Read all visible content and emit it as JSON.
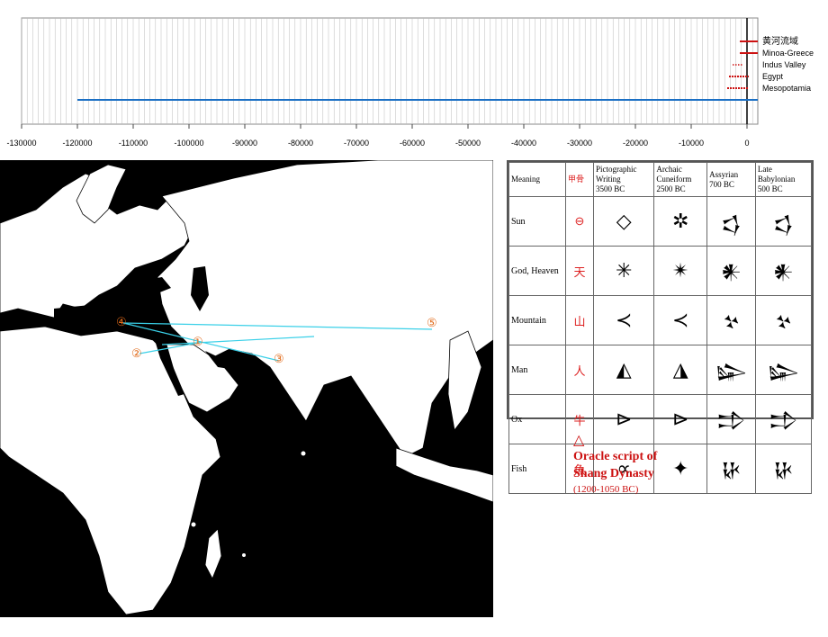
{
  "timeline": {
    "axis_ticks": [
      "-130000",
      "-120000",
      "-110000",
      "-100000",
      "-90000",
      "-80000",
      "-70000",
      "-60000",
      "-50000",
      "-40000",
      "-30000",
      "-20000",
      "-10000",
      "0"
    ],
    "legend": [
      "黄河流域",
      "Minoa-Greece",
      "Indus Valley",
      "Egypt",
      "Mesopotamia"
    ],
    "colors": {
      "bar": "#1a6fc4",
      "legend": "#cc1111",
      "grid": "#bbbbbb"
    }
  },
  "map": {
    "markers": [
      "④",
      "②",
      "①",
      "③",
      "⑤"
    ],
    "colors": {
      "land": "#ffffff",
      "water": "#000000",
      "link": "#3ad0e8",
      "marker": "#e06a1a"
    }
  },
  "table": {
    "headers": {
      "meaning": "Meaning",
      "oracle": "甲骨",
      "pictographic": [
        "Pictographic",
        "Writing",
        "3500 BC"
      ],
      "archaic": [
        "Archaic",
        "Cuneiform",
        "2500 BC"
      ],
      "assyrian": [
        "Assyrian",
        "",
        "700 BC"
      ],
      "babylonian": [
        "Late",
        "Babylonian",
        "500 BC"
      ]
    },
    "rows": [
      {
        "meaning": "Sun",
        "oracle": "⊖",
        "g": [
          "◇",
          "✲",
          "𒌓",
          "𒌓"
        ]
      },
      {
        "meaning": "God, Heaven",
        "oracle": "天",
        "g": [
          "✳",
          "✴",
          "𒀭",
          "𒀭"
        ]
      },
      {
        "meaning": "Mountain",
        "oracle": "山",
        "g": [
          "≺",
          "≺",
          "𒆳",
          "𒆳"
        ]
      },
      {
        "meaning": "Man",
        "oracle": "人",
        "g": [
          "◭",
          "◮",
          "𒇽",
          "𒇽"
        ]
      },
      {
        "meaning": "Ox",
        "oracle": "牛",
        "g": [
          "⊳",
          "⊳",
          "𒄞",
          "𒄞"
        ]
      },
      {
        "meaning": "Fish",
        "oracle": "魚",
        "g": [
          "∝",
          "✦",
          "𒄩",
          "𒄩"
        ]
      }
    ]
  },
  "note": {
    "symbol": "△",
    "title": "Oracle script of Shang Dynasty",
    "range": "(1200-1050 BC)"
  }
}
